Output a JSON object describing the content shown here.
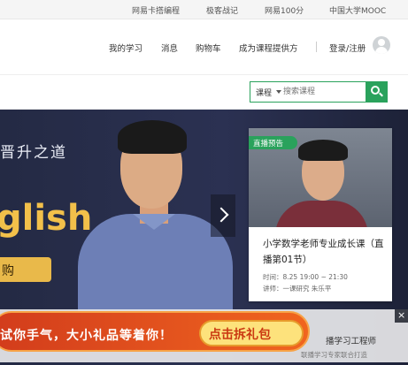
{
  "topbar": {
    "links": [
      "网易卡搭编程",
      "极客战记",
      "网易100分",
      "中国大学MOOC"
    ]
  },
  "nav": {
    "items": [
      "我的学习",
      "消息",
      "购物车",
      "成为课程提供方"
    ],
    "login": "登录/注册"
  },
  "search": {
    "category": "课程",
    "placeholder": "搜索课程"
  },
  "banner": {
    "headline": "晋升之道",
    "big_word": "glish",
    "buy_label": "购"
  },
  "live_card": {
    "tag": "直播预告",
    "title": "小学数学老师专业成长课（直播第01节）",
    "time": "时间：8.25 19:00 ~ 21:30",
    "teacher": "讲师：一课研究 朱乐平"
  },
  "promo": {
    "slogan": "试你手气，大小礼品等着你！",
    "cta": "点击拆礼包",
    "close": "×",
    "behind_text": "播学习工程师",
    "behind_sub": "联播学习专家联合打造"
  },
  "colors": {
    "accent_green": "#2aa25c",
    "banner_bg": "#2b3152",
    "gold": "#f2c04a",
    "promo_red": "#e04a1c"
  }
}
